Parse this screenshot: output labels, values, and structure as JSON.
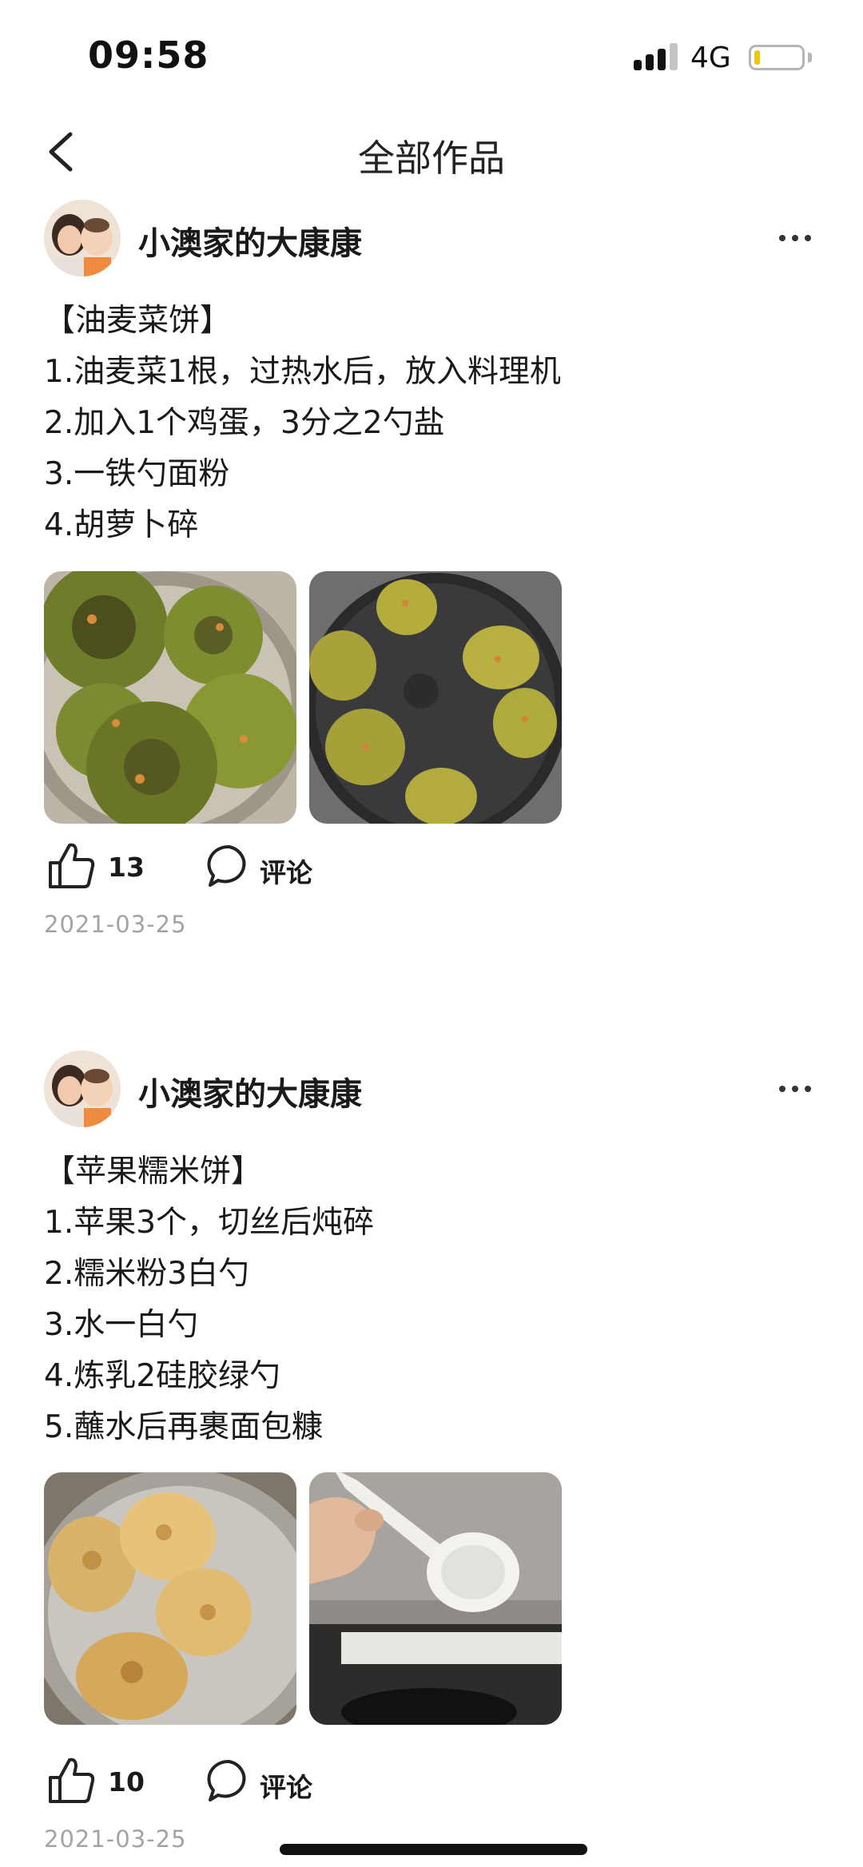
{
  "status_bar": {
    "time": "09:58",
    "network": "4G",
    "battery_level": 0.12,
    "battery_color": "#f2c500",
    "signal_bars": 4,
    "signal_active_bars": 3
  },
  "nav": {
    "back_icon": "chevron-left-icon",
    "title": "全部作品"
  },
  "posts": [
    {
      "author": "小澳家的大康康",
      "more_icon": "ellipsis-icon",
      "lines": [
        "【油麦菜饼】",
        "1.油麦菜1根，过热水后，放入料理机",
        "2.加入1个鸡蛋，3分之2勺盐",
        "3.一铁勺面粉",
        "4.胡萝卜碎"
      ],
      "images": [
        "pancakes-on-plate-photo",
        "pancakes-in-pan-photo"
      ],
      "likes": "13",
      "comment_label": "评论",
      "date": "2021-03-25"
    },
    {
      "author": "小澳家的大康康",
      "more_icon": "ellipsis-icon",
      "lines": [
        "【苹果糯米饼】",
        "1.苹果3个，切丝后炖碎",
        "2.糯米粉3白勺",
        "3.水一白勺",
        "4.炼乳2硅胶绿勺",
        "5.蘸水后再裹面包糠"
      ],
      "images": [
        "fried-rice-cakes-photo",
        "white-ladle-photo"
      ],
      "likes": "10",
      "comment_label": "评论",
      "date": "2021-03-25"
    }
  ],
  "colors": {
    "text": "#1a1a1a",
    "date": "#a3a3a3",
    "background": "#ffffff"
  }
}
